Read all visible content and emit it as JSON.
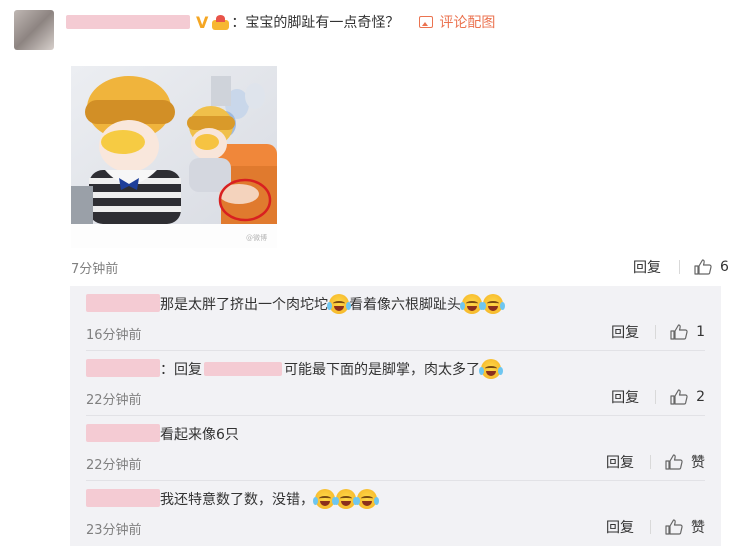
{
  "comment": {
    "text": "：宝宝的脚趾有一点奇怪？",
    "pic_link": "评论配图",
    "time": "7分钟前",
    "reply_label": "回复",
    "like_count": "6"
  },
  "photo": {
    "caption": "@微博"
  },
  "replies": [
    {
      "text_parts": [
        "那是太胖了挤出一个肉坨坨",
        "看着像六根脚趾头"
      ],
      "emoji_counts": [
        1,
        2
      ],
      "time": "16分钟前",
      "reply_label": "回复",
      "like": "1"
    },
    {
      "prefix": "：回复",
      "text": "可能最下面的是脚掌，肉太多了",
      "emoji_count": 1,
      "time": "22分钟前",
      "reply_label": "回复",
      "like": "2"
    },
    {
      "text": "看起来像6只",
      "time": "22分钟前",
      "reply_label": "回复",
      "like": "赞"
    },
    {
      "text": "我还特意数了数，没错，",
      "emoji_count": 3,
      "time": "23分钟前",
      "reply_label": "回复",
      "like": "赞"
    }
  ],
  "icons": [
    "thumbs-up-icon",
    "image-icon",
    "laugh-cry-emoji",
    "verified-v-icon",
    "crown-badge-icon"
  ],
  "colors": {
    "link": "#eb7350",
    "verified": "#f5a623",
    "reply_bg": "#f2f2f5",
    "time": "#808080"
  }
}
